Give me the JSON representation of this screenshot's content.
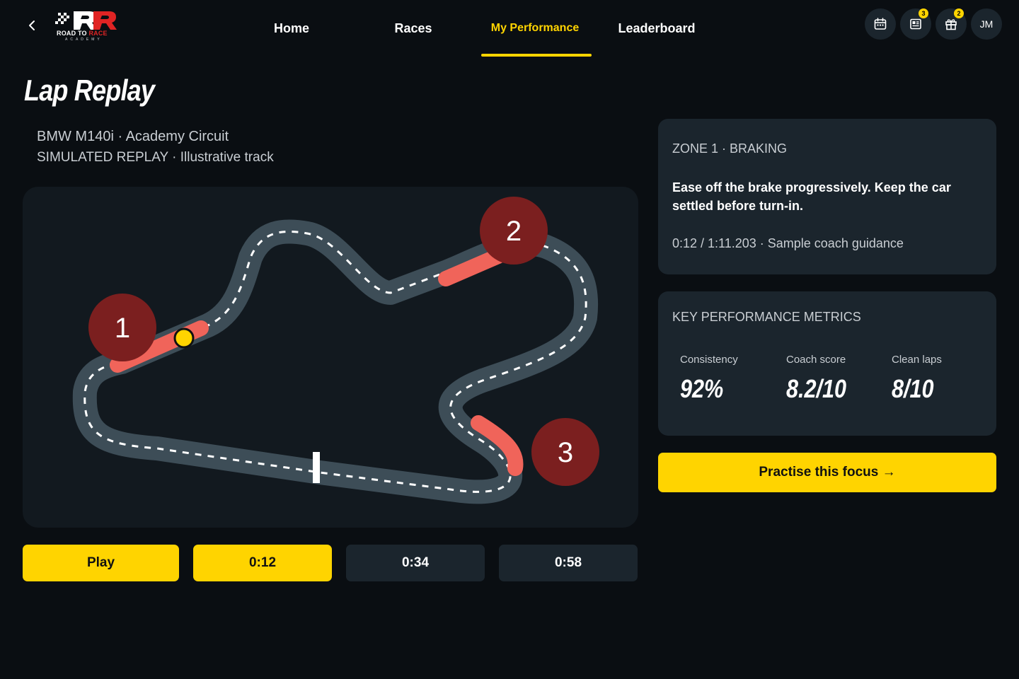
{
  "header": {
    "back_icon": "chevron-left-icon",
    "logo": {
      "text_main": "ROAD TO ",
      "text_accent": "RACE",
      "text_sub": "ACADEMY"
    },
    "nav": [
      {
        "label": "Home",
        "active": false
      },
      {
        "label": "Races",
        "active": false
      },
      {
        "label": "My Performance",
        "active": true
      },
      {
        "label": "Leaderboard",
        "active": false
      }
    ],
    "icons": [
      {
        "name": "calendar-icon",
        "badge": ""
      },
      {
        "name": "news-icon",
        "badge": "3"
      },
      {
        "name": "gift-icon",
        "badge": "2"
      }
    ],
    "avatar_initials": "JM"
  },
  "page": {
    "title": "Lap Replay",
    "subtitle_car_track": "BMW M140i · Academy Circuit",
    "subtitle_mode": "SIMULATED REPLAY · Illustrative track"
  },
  "track": {
    "markers": [
      {
        "label": "1"
      },
      {
        "label": "2"
      },
      {
        "label": "3"
      }
    ],
    "colors": {
      "track": "#3d4d57",
      "zone": "#f0645a",
      "marker": "#7b1f1f",
      "car": "#ffd400"
    }
  },
  "controls": {
    "play_label": "Play",
    "timestamps": [
      {
        "label": "0:12",
        "active": true
      },
      {
        "label": "0:34",
        "active": false
      },
      {
        "label": "0:58",
        "active": false
      }
    ]
  },
  "zone_card": {
    "title": "ZONE 1 · BRAKING",
    "body": "Ease off the brake progressively. Keep the car settled before turn-in.",
    "meta": "0:12 / 1:11.203 · Sample coach guidance"
  },
  "metrics": {
    "title": "KEY PERFORMANCE METRICS",
    "items": [
      {
        "label": "Consistency",
        "value": "92%"
      },
      {
        "label": "Coach score",
        "value": "8.2/10"
      },
      {
        "label": "Clean laps",
        "value": "8/10"
      }
    ]
  },
  "cta_label": "Practise this focus →",
  "colors": {
    "accent": "#ffd400",
    "background": "#0a0e12",
    "card": "#1b252d"
  }
}
